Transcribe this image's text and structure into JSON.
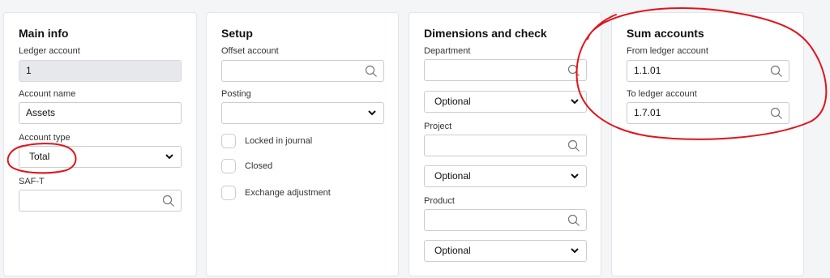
{
  "main_info": {
    "title": "Main info",
    "ledger_account_label": "Ledger account",
    "ledger_account_value": "1",
    "account_name_label": "Account name",
    "account_name_value": "Assets",
    "account_type_label": "Account type",
    "account_type_value": "Total",
    "saft_label": "SAF-T",
    "saft_value": ""
  },
  "setup": {
    "title": "Setup",
    "offset_account_label": "Offset account",
    "offset_account_value": "",
    "posting_label": "Posting",
    "posting_value": "",
    "checkboxes": [
      {
        "label": "Locked in journal",
        "checked": false
      },
      {
        "label": "Closed",
        "checked": false
      },
      {
        "label": "Exchange adjustment",
        "checked": false
      }
    ]
  },
  "dimensions": {
    "title": "Dimensions and check",
    "department_label": "Department",
    "department_value": "",
    "department_check": "Optional",
    "project_label": "Project",
    "project_value": "",
    "project_check": "Optional",
    "product_label": "Product",
    "product_value": "",
    "product_check": "Optional"
  },
  "sum_accounts": {
    "title": "Sum accounts",
    "from_label": "From ledger account",
    "from_value": "1.1.01",
    "to_label": "To ledger account",
    "to_value": "1.7.01"
  },
  "icons": {
    "search": "search-icon",
    "dropdown": "chevron-down-icon"
  },
  "colors": {
    "annotation": "#e0141b",
    "readonly_bg": "#e7e8eb",
    "border": "#c9ccd2"
  }
}
